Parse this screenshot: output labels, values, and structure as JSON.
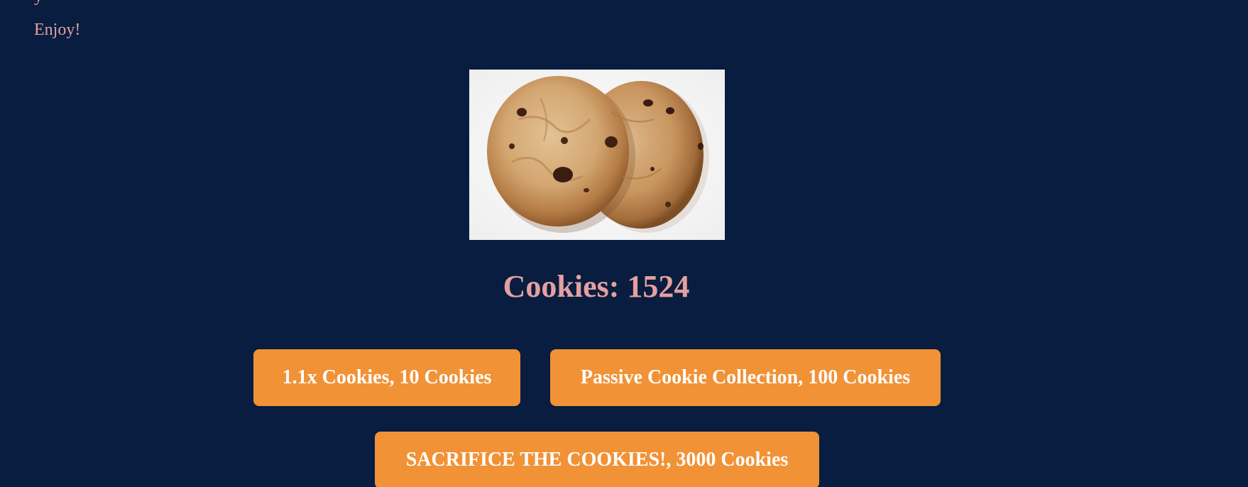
{
  "header": {
    "intro_fragment": "y",
    "enjoy_text": "Enjoy!"
  },
  "cookie": {
    "image_icon": "chocolate-chip-cookie-image"
  },
  "counter": {
    "text": "Cookies: 1524",
    "count": 1524
  },
  "upgrades": [
    {
      "label": "1.1x Cookies, 10 Cookies"
    },
    {
      "label": "Passive Cookie Collection, 100 Cookies"
    },
    {
      "label": "SACRIFICE THE COOKIES!, 3000 Cookies"
    }
  ],
  "colors": {
    "background": "#081d3f",
    "text_accent": "#e69fa0",
    "button": "#f19236",
    "button_text": "#ffffff"
  }
}
